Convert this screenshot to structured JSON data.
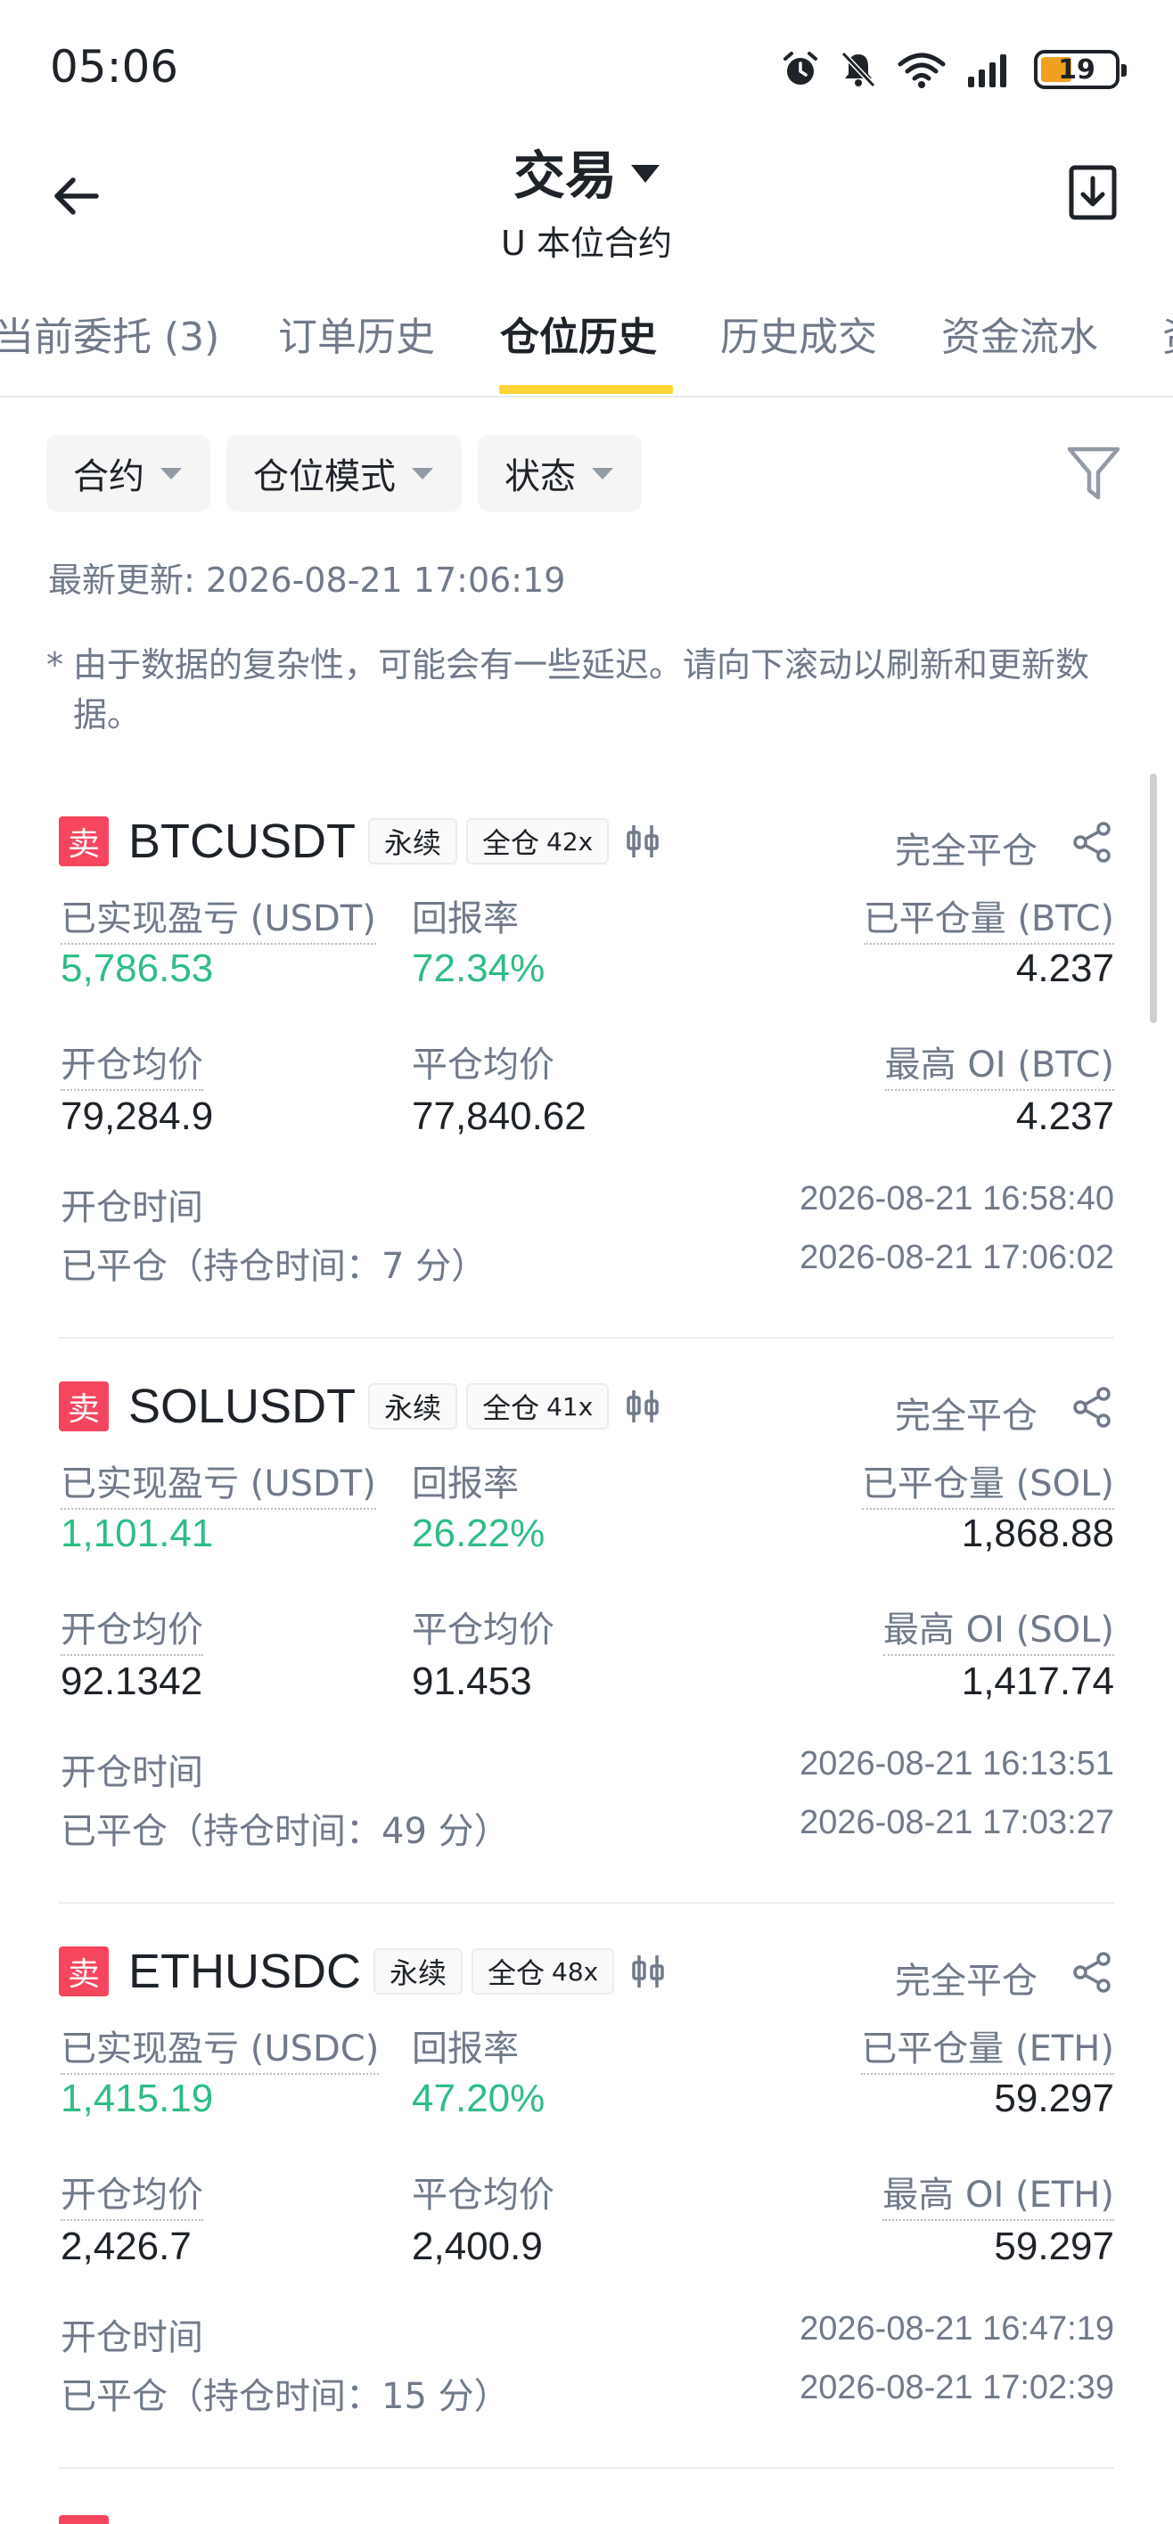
{
  "status_bar": {
    "time": "05:06",
    "battery": "19",
    "icons": [
      "alarm-icon",
      "mute-icon",
      "wifi-icon",
      "signal-icon",
      "battery-icon"
    ]
  },
  "header": {
    "title": "交易",
    "subtitle": "U 本位合约"
  },
  "tabs": [
    {
      "label": "当前委托 (3)"
    },
    {
      "label": "订单历史"
    },
    {
      "label": "仓位历史",
      "active": true
    },
    {
      "label": "历史成交"
    },
    {
      "label": "资金流水"
    },
    {
      "label": "资"
    }
  ],
  "filters": {
    "contract": "合约",
    "position_mode": "仓位模式",
    "status": "状态"
  },
  "updated": "最新更新: 2026-08-21 17:06:19",
  "note": {
    "star": "*",
    "text": "由于数据的复杂性，可能会有一些延迟。请向下滚动以刷新和更新数据。"
  },
  "colors": {
    "accent": "#fcd535",
    "sell": "#f6465d",
    "profit": "#2ebd85",
    "muted": "#707a8a"
  },
  "positions": [
    {
      "side": "卖",
      "symbol": "BTCUSDT",
      "type": "永续",
      "margin_mode": "全仓",
      "leverage": "42x",
      "status": "完全平仓",
      "pnl_label": "已实现盈亏 (USDT)",
      "pnl": "5,786.53",
      "roi_label": "回报率",
      "roi": "72.34%",
      "closed_qty_label": "已平仓量 (BTC)",
      "closed_qty": "4.237",
      "open_price_label": "开仓均价",
      "open_price": "79,284.9",
      "close_price_label": "平仓均价",
      "close_price": "77,840.62",
      "max_oi_label": "最高 OI (BTC)",
      "max_oi": "4.237",
      "open_time_label": "开仓时间",
      "open_time": "2026-08-21 16:58:40",
      "closed_label": "已平仓（持仓时间：7 分）",
      "close_time": "2026-08-21 17:06:02"
    },
    {
      "side": "卖",
      "symbol": "SOLUSDT",
      "type": "永续",
      "margin_mode": "全仓",
      "leverage": "41x",
      "status": "完全平仓",
      "pnl_label": "已实现盈亏 (USDT)",
      "pnl": "1,101.41",
      "roi_label": "回报率",
      "roi": "26.22%",
      "closed_qty_label": "已平仓量 (SOL)",
      "closed_qty": "1,868.88",
      "open_price_label": "开仓均价",
      "open_price": "92.1342",
      "close_price_label": "平仓均价",
      "close_price": "91.453",
      "max_oi_label": "最高 OI (SOL)",
      "max_oi": "1,417.74",
      "open_time_label": "开仓时间",
      "open_time": "2026-08-21 16:13:51",
      "closed_label": "已平仓（持仓时间：49 分）",
      "close_time": "2026-08-21 17:03:27"
    },
    {
      "side": "卖",
      "symbol": "ETHUSDC",
      "type": "永续",
      "margin_mode": "全仓",
      "leverage": "48x",
      "status": "完全平仓",
      "pnl_label": "已实现盈亏 (USDC)",
      "pnl": "1,415.19",
      "roi_label": "回报率",
      "roi": "47.20%",
      "closed_qty_label": "已平仓量 (ETH)",
      "closed_qty": "59.297",
      "open_price_label": "开仓均价",
      "open_price": "2,426.7",
      "close_price_label": "平仓均价",
      "close_price": "2,400.9",
      "max_oi_label": "最高 OI (ETH)",
      "max_oi": "59.297",
      "open_time_label": "开仓时间",
      "open_time": "2026-08-21 16:47:19",
      "closed_label": "已平仓（持仓时间：15 分）",
      "close_time": "2026-08-21 17:02:39"
    }
  ]
}
